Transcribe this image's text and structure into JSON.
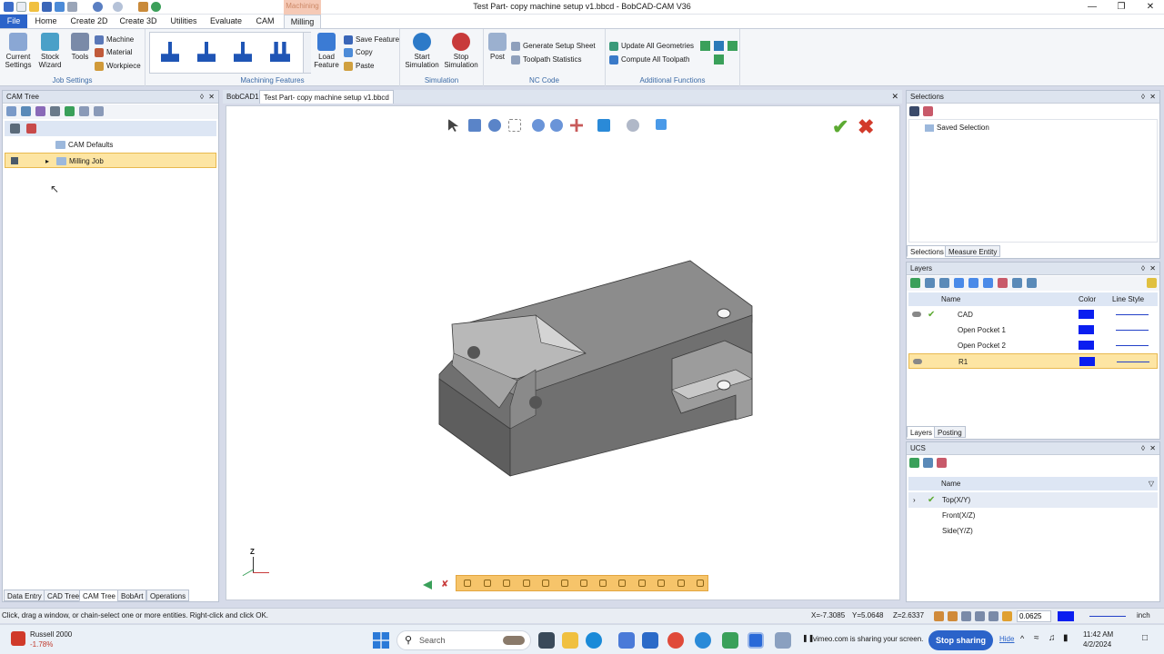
{
  "window": {
    "title": "Test Part- copy machine setup v1.bbcd - BobCAD-CAM V36"
  },
  "ribbon": {
    "context_label": "Machining",
    "tabs": [
      "File",
      "Home",
      "Create 2D",
      "Create 3D",
      "Utilities",
      "Evaluate",
      "CAM",
      "Milling"
    ],
    "active_tab": "Milling",
    "groups": {
      "job_settings": "Job Settings",
      "machining_features": "Machining Features",
      "simulation": "Simulation",
      "nc_code": "NC Code",
      "additional_functions": "Additional Functions"
    },
    "current_settings": "Current Settings",
    "stock_wizard": "Stock Wizard",
    "tools": "Tools",
    "machine": "Machine",
    "material": "Material",
    "workpiece": "Workpiece",
    "load_feature": "Load Feature",
    "save_feature": "Save Feature",
    "copy": "Copy",
    "paste": "Paste",
    "start_simulation": "Start Simulation",
    "stop_simulation": "Stop Simulation",
    "post": "Post",
    "generate_setup_sheet": "Generate Setup Sheet",
    "toolpath_statistics": "Toolpath Statistics",
    "update_all_geometries": "Update All Geometries",
    "compute_all_toolpath": "Compute All Toolpath"
  },
  "cam_tree": {
    "title": "CAM Tree",
    "items": [
      {
        "label": "CAM Defaults",
        "selected": false
      },
      {
        "label": "Milling Job",
        "selected": true
      }
    ],
    "bottom_tabs": [
      "Data Entry",
      "CAD Tree",
      "CAM Tree",
      "BobArt",
      "Operations"
    ],
    "active_tab": "CAM Tree"
  },
  "document": {
    "tabs": [
      "BobCAD1",
      "Test Part- copy machine setup v1.bbcd"
    ],
    "active_tab": "Test Part- copy machine setup v1.bbcd",
    "axis_label": "Z"
  },
  "selections": {
    "title": "Selections",
    "items": [
      "Saved Selection"
    ],
    "tabs": [
      "Selections",
      "Measure Entity"
    ]
  },
  "layers": {
    "title": "Layers",
    "columns": [
      "Name",
      "Color",
      "Line Style"
    ],
    "rows": [
      {
        "name": "CAD",
        "visible": true,
        "active": true,
        "selected": false,
        "color": "#0a1ef0"
      },
      {
        "name": "Open Pocket 1",
        "visible": false,
        "active": false,
        "selected": false,
        "color": "#0a1ef0"
      },
      {
        "name": "Open Pocket 2",
        "visible": false,
        "active": false,
        "selected": false,
        "color": "#0a1ef0"
      },
      {
        "name": "R1",
        "visible": true,
        "active": false,
        "selected": true,
        "color": "#0a1ef0"
      }
    ],
    "tabs": [
      "Layers",
      "Posting"
    ]
  },
  "ucs": {
    "title": "UCS",
    "column": "Name",
    "rows": [
      {
        "name": "Top(X/Y)",
        "active": true
      },
      {
        "name": "Front(X/Z)",
        "active": false
      },
      {
        "name": "Side(Y/Z)",
        "active": false
      }
    ]
  },
  "status": {
    "message": "Click, drag a window, or chain-select one or more entities. Right-click and click OK.",
    "x": "X=-7.3085",
    "y": "Y=5.0648",
    "z": "Z=2.6337",
    "step_value": "0.0625",
    "units": "inch"
  },
  "taskbar": {
    "ticker_name": "Russell 2000",
    "ticker_change": "-1.78%",
    "search_placeholder": "Search",
    "sharing_text": "vimeo.com is sharing your screen.",
    "stop_sharing": "Stop sharing",
    "hide": "Hide",
    "time": "11:42 AM",
    "date": "4/2/2024"
  },
  "colors": {
    "accent": "#2b63c9",
    "selection_highlight": "#fde5a3",
    "layer_color": "#0a1ef0"
  }
}
